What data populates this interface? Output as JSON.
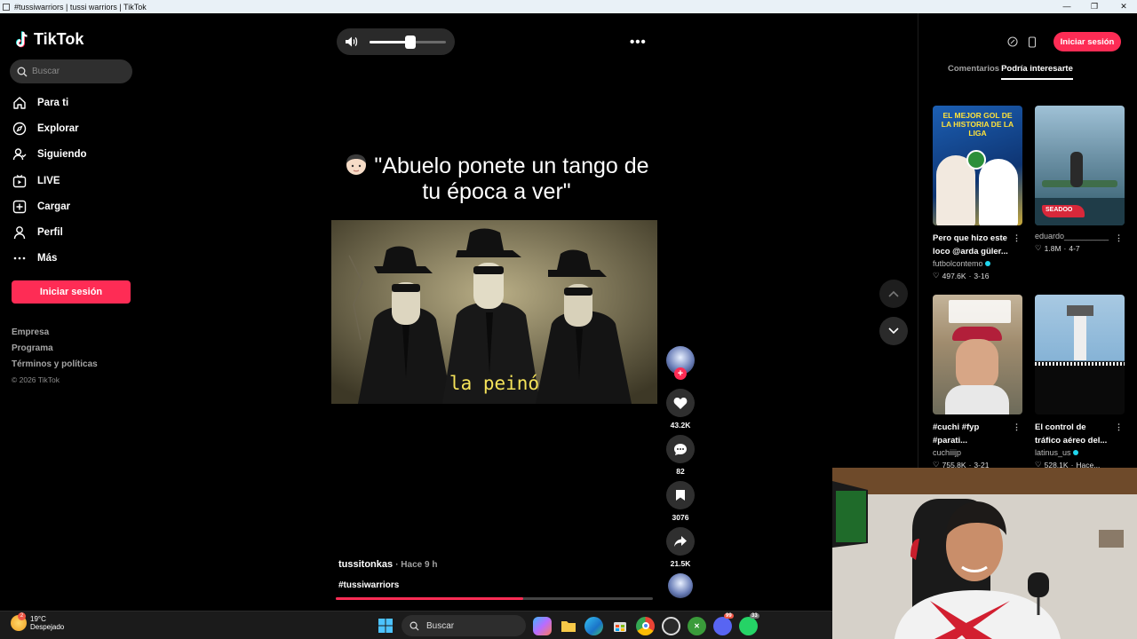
{
  "window": {
    "title": "#tussiwarriors | tussi warriors | TikTok"
  },
  "colors": {
    "accent": "#fe2c55",
    "background": "#000000",
    "verified": "#20d5ec"
  },
  "sidebar": {
    "brand": "TikTok",
    "search_placeholder": "Buscar",
    "items": [
      {
        "label": "Para ti",
        "icon": "home-icon"
      },
      {
        "label": "Explorar",
        "icon": "compass-icon"
      },
      {
        "label": "Siguiendo",
        "icon": "following-icon"
      },
      {
        "label": "LIVE",
        "icon": "live-icon"
      },
      {
        "label": "Cargar",
        "icon": "upload-icon"
      },
      {
        "label": "Perfil",
        "icon": "profile-icon"
      },
      {
        "label": "Más",
        "icon": "more-icon"
      }
    ],
    "login_label": "Iniciar sesión",
    "footer": [
      "Empresa",
      "Programa",
      "Términos y políticas"
    ],
    "copyright": "© 2026 TikTok"
  },
  "player": {
    "volume_level": 0.54,
    "caption_text": "\"Abuelo ponete un tango de tu época a ver\"",
    "video_subtitle": "la peinó",
    "author": "tussitonkas",
    "time": "· Hace 9 h",
    "hashtags": "#tussiwarriors",
    "progress": 0.59
  },
  "actions": {
    "likes": "43.2K",
    "comments": "82",
    "saves": "3076",
    "shares": "21.5K"
  },
  "right_panel": {
    "login_label": "Iniciar sesión",
    "tabs": [
      "Comentarios",
      "Podría interesarte"
    ],
    "active_tab": 1,
    "cards": [
      {
        "title": "Pero que hizo este loco @arda güler...",
        "author": "futbolcontemo",
        "verified": true,
        "likes": "497.6K",
        "date": "3-16",
        "thumb_text": "EL MEJOR GOL DE LA HISTORIA DE LA LIGA"
      },
      {
        "title": "",
        "author": "eduardo__________",
        "verified": false,
        "likes": "1.8M",
        "date": "4-7",
        "thumb_text": "SEADOO"
      },
      {
        "title": "#cuchi #fyp #parati...",
        "author": "cuchiiijp",
        "verified": false,
        "likes": "755.8K",
        "date": "3-21",
        "thumb_text": ""
      },
      {
        "title": "El control de tráfico aéreo del...",
        "author": "latinus_us",
        "verified": true,
        "likes": "528.1K",
        "date": "Hace...",
        "thumb_text": ""
      }
    ]
  },
  "taskbar": {
    "temperature": "19°C",
    "weather": "Despejado",
    "search_label": "Buscar",
    "discord_badge": "99",
    "whatsapp_badge": "33"
  }
}
